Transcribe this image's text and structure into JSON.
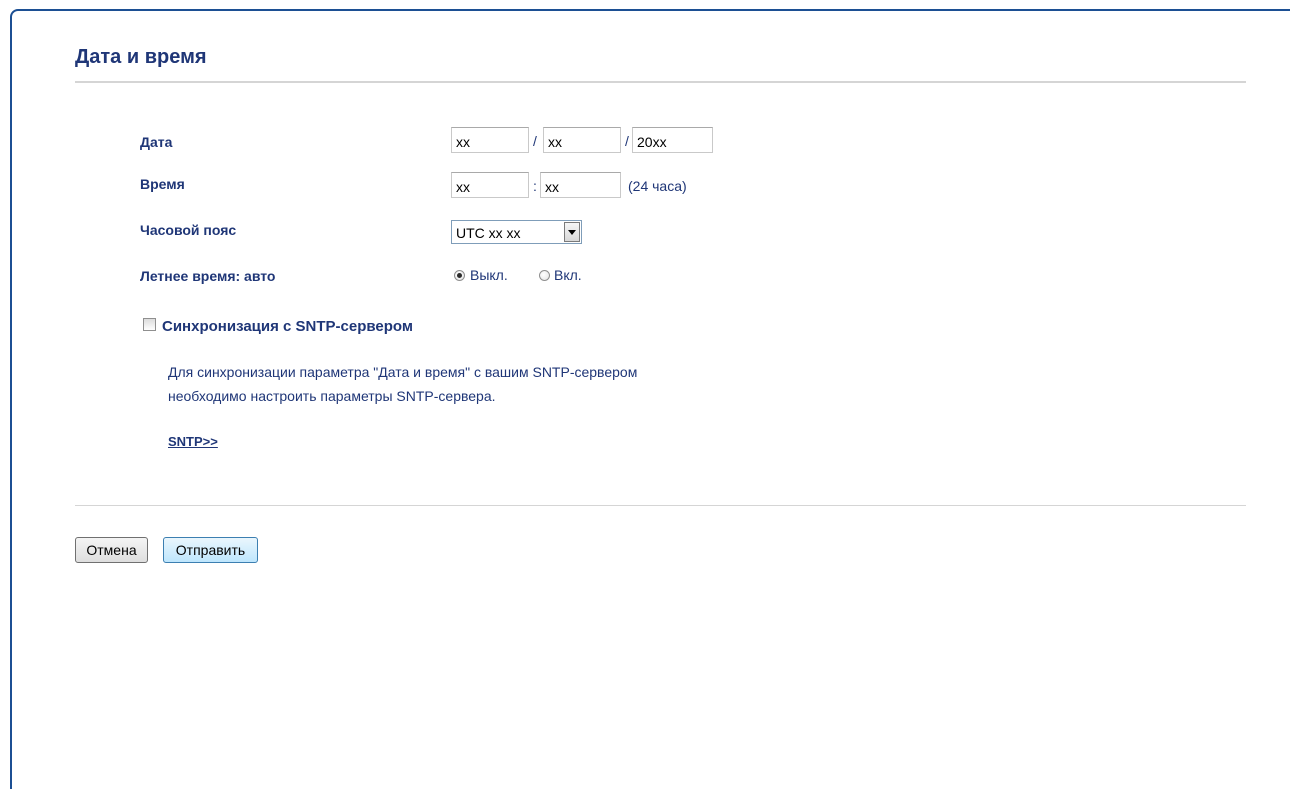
{
  "page": {
    "title": "Дата и время"
  },
  "form": {
    "date": {
      "label": "Дата",
      "day": "xx",
      "month": "xx",
      "year": "20xx",
      "separator": "/"
    },
    "time": {
      "label": "Время",
      "hours": "xx",
      "minutes": "xx",
      "separator": ":",
      "format_note": "(24 часа)"
    },
    "timezone": {
      "label": "Часовой пояс",
      "selected": "UTC  xx xx"
    },
    "dst": {
      "label": "Летнее время: авто",
      "options": [
        "Выкл.",
        "Вкл."
      ],
      "selected": "Выкл."
    }
  },
  "sntp": {
    "checkbox_label": "Синхронизация с SNTP-сервером",
    "checked": false,
    "description_line1": "Для синхронизации параметра \"Дата и время\" с вашим SNTP-сервером",
    "description_line2": "необходимо настроить параметры SNTP-сервера.",
    "link_label": "SNTP>>"
  },
  "buttons": {
    "cancel_label": "Отмена",
    "submit_label": "Отправить"
  },
  "colors": {
    "frame_border": "#1c4f93",
    "text": "#1f3677",
    "rule": "#d5d5d5"
  },
  "icons": {
    "dropdown": "dropdown-arrow-icon"
  }
}
